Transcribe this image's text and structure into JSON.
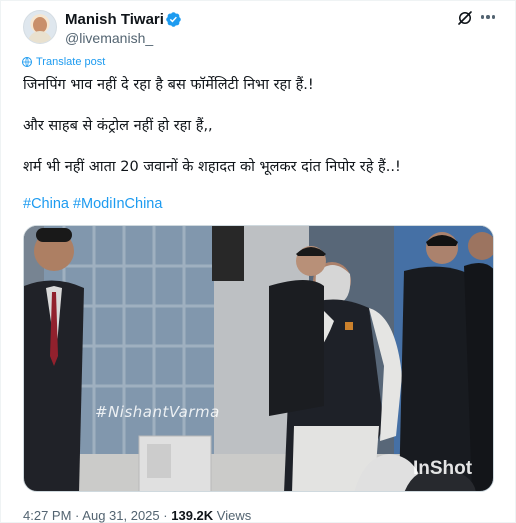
{
  "author": {
    "name": "Manish Tiwari",
    "handle": "@livemanish_",
    "verified_color": "#1d9bf0"
  },
  "header_icons": [
    "grok-icon",
    "more-options-icon"
  ],
  "translate_label": "Translate post",
  "post": {
    "lines": [
      "जिनपिंग भाव नहीं दे रहा है बस फॉर्मेलिटी निभा रहा हैं.!",
      "और साहब से कंट्रोल नहीं हो रहा हैं,,",
      "शर्म भी नहीं आता 20 जवानों के शहादत को भूलकर दांत निपोर रहे हैं..!"
    ],
    "hashtags": [
      "#China",
      "#ModiInChina"
    ]
  },
  "media": {
    "watermark": "#NishantVarma",
    "app_label": "InShot"
  },
  "meta": {
    "time": "4:27 PM",
    "separator": "·",
    "date": "Aug 31, 2025",
    "views_count": "139.2K",
    "views_label": "Views"
  },
  "colors": {
    "accent": "#1d9bf0",
    "secondary_text": "#536471"
  }
}
